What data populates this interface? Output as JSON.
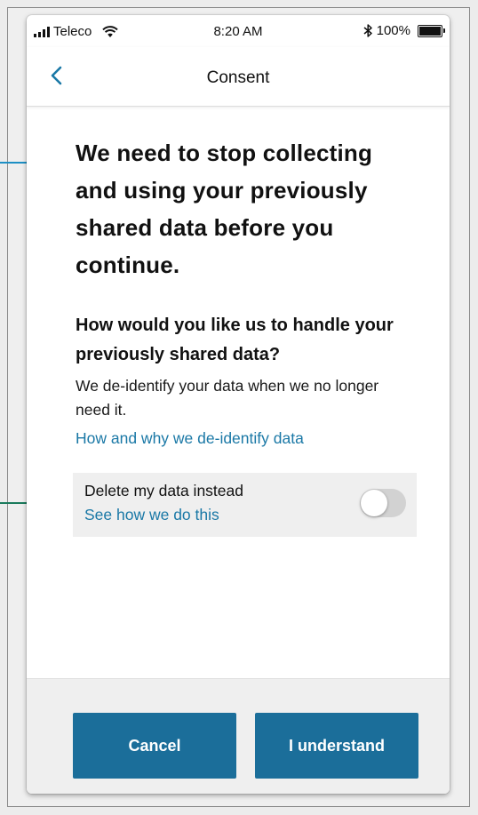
{
  "status_bar": {
    "carrier": "Teleco",
    "time": "8:20 AM",
    "battery": "100%"
  },
  "nav": {
    "title": "Consent"
  },
  "content": {
    "heading": "We need to stop collecting and using your previously shared data before you continue.",
    "subheading": "How would you like us to handle your previously shared data?",
    "body": "We de-identify your data when we no longer need it.",
    "link": "How and why we de-identify data",
    "toggle_label": "Delete my data instead",
    "toggle_link": "See how we do this",
    "toggle_on": false
  },
  "footer": {
    "cancel_label": "Cancel",
    "confirm_label": "I understand"
  },
  "colors": {
    "primary_button": "#1b6e9a",
    "link": "#1a78a6",
    "arrow_top": "#1d8fc4",
    "arrow_bottom": "#1a7a5c"
  }
}
